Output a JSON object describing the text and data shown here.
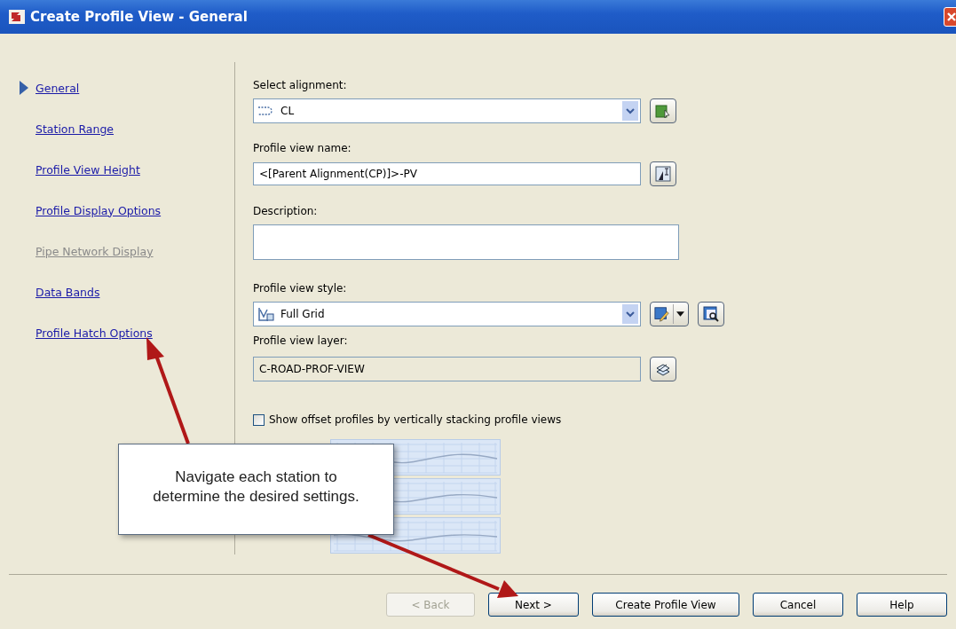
{
  "window": {
    "title": "Create Profile View - General"
  },
  "nav": [
    {
      "label": "General",
      "selected": true,
      "disabled": false
    },
    {
      "label": "Station Range",
      "selected": false,
      "disabled": false
    },
    {
      "label": "Profile View Height",
      "selected": false,
      "disabled": false
    },
    {
      "label": "Profile Display Options",
      "selected": false,
      "disabled": false
    },
    {
      "label": "Pipe Network Display",
      "selected": false,
      "disabled": true
    },
    {
      "label": "Data Bands",
      "selected": false,
      "disabled": false
    },
    {
      "label": "Profile Hatch Options",
      "selected": false,
      "disabled": false
    }
  ],
  "alignment": {
    "label": "Select alignment:",
    "value": "CL"
  },
  "view_name": {
    "label": "Profile view name:",
    "value": "<[Parent Alignment(CP)]>-PV"
  },
  "description": {
    "label": "Description:"
  },
  "view_style": {
    "label": "Profile view style:",
    "value": "Full Grid"
  },
  "view_layer": {
    "label": "Profile view layer:",
    "value": "C-ROAD-PROF-VIEW"
  },
  "stacking": {
    "label": "Show offset profiles by vertically stacking profile views",
    "checked": false
  },
  "callout": {
    "text": "Navigate each station to determine the desired settings."
  },
  "buttons": [
    {
      "label": "< Back",
      "disabled": true
    },
    {
      "label": "Next >",
      "disabled": false
    },
    {
      "label": "Create Profile View",
      "disabled": false
    },
    {
      "label": "Cancel",
      "disabled": false
    },
    {
      "label": "Help",
      "disabled": false
    }
  ]
}
